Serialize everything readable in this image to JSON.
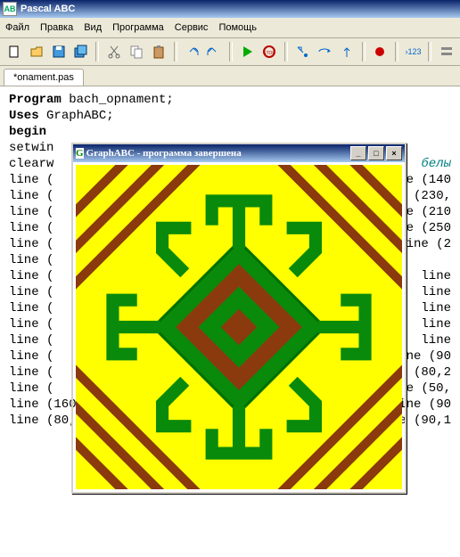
{
  "window": {
    "title": "Pascal ABC"
  },
  "menu": {
    "file": "Файл",
    "edit": "Правка",
    "view": "Вид",
    "program": "Программа",
    "service": "Сервис",
    "help": "Помощь"
  },
  "tab": {
    "name": "*onament.pas"
  },
  "code": {
    "l1": "Program",
    "l1b": " bach_opnament;",
    "l2": "Uses",
    "l2b": " GraphABC;",
    "l3": "begin",
    "l4": "setwin",
    "l5": "clearw",
    "l5c": "белы",
    "l6": "line (",
    "l6b": "e (140",
    "l7": "line (",
    "l7b": " (230,",
    "l8": "line (",
    "l8b": "e (210",
    "l9": "line (",
    "l9b": "e (250",
    "l10": "line (",
    "l10b": "ine (2",
    "l11": "line (",
    "l12": "line (",
    "l12b": "line",
    "l13": "line (",
    "l13b": "line",
    "l14": "line (",
    "l14b": "line",
    "l15": "line (",
    "l15b": "line",
    "l16": "line (",
    "l16b": "line",
    "l17": "line (",
    "l17b": "ne (90",
    "l18": "line (",
    "l18b": " (80,2",
    "l19": "line (",
    "l19b": "e (50,",
    "l20": "line (160,90,140,90); line (140,90,140,130,80);",
    "l20b": "ine (90",
    "l21": "line (80,130,70,140); line (70,140,90,160);",
    "l21b": "line (90,1"
  },
  "graph": {
    "title": "GraphABC - программа завершена",
    "min": "_",
    "max": "□",
    "close": "×"
  }
}
